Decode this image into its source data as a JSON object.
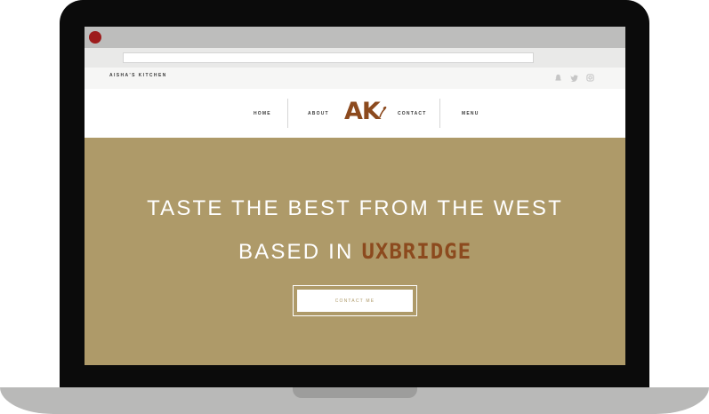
{
  "site": {
    "name": "AISHA'S KITCHEN",
    "logo_text": "AK",
    "social_icons": [
      "snapchat-icon",
      "twitter-icon",
      "instagram-icon"
    ]
  },
  "nav": {
    "items": [
      {
        "label": "HOME"
      },
      {
        "label": "ABOUT"
      },
      {
        "label": "CONTACT"
      },
      {
        "label": "MENU"
      }
    ]
  },
  "hero": {
    "line1": "TASTE THE BEST FROM THE WEST",
    "line2_prefix": "BASED IN",
    "line2_accent": "UXBRIDGE",
    "cta_label": "CONTACT ME"
  },
  "colors": {
    "hero_background": "#ae9a69",
    "brand_brown": "#8c4a1e",
    "close_button": "#9d1c1c"
  }
}
